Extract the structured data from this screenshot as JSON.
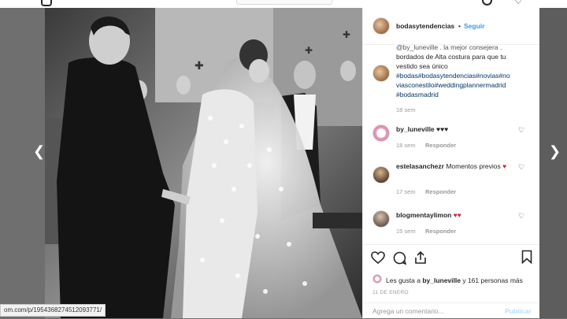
{
  "post": {
    "author": "bodasytendencias",
    "follow_label": "Seguir",
    "separator": "•",
    "caption_lines": [
      "@by_luneville . la mejor consejera .",
      "bordados de Alta costura para que tu",
      "vestido sea único"
    ],
    "caption_tags": [
      "#bodas#bodasytendencias#novias#no",
      "viasconestilo#weddingplannermadrid",
      "#bodasmadrid"
    ],
    "caption_time": "18 sem",
    "likes_prefix": "Les gusta a ",
    "likes_user": "by_luneville",
    "likes_suffix": " y 161 personas más",
    "date": "11 DE ENERO",
    "add_comment_placeholder": "Agrega un comentario...",
    "publish_label": "Publicar"
  },
  "comments": [
    {
      "user": "by_luneville",
      "text": "♥♥♥",
      "time": "18 sem",
      "reply": "Responder"
    },
    {
      "user": "estelasanchezr",
      "text": "Momentos previos",
      "emoji": "♥",
      "time": "17 sem",
      "reply": "Responder"
    },
    {
      "user": "blogmentaylimon",
      "text": "",
      "emoji": "♥♥",
      "time": "15 sem",
      "reply": "Responder"
    }
  ],
  "status_url": "om.com/p/1954368274512093771/",
  "nav": {
    "prev": "❮",
    "next": "❯"
  },
  "colors": {
    "link": "#3897f0",
    "hashtag": "#003569",
    "heart": "#d1243a",
    "muted": "#999999"
  }
}
